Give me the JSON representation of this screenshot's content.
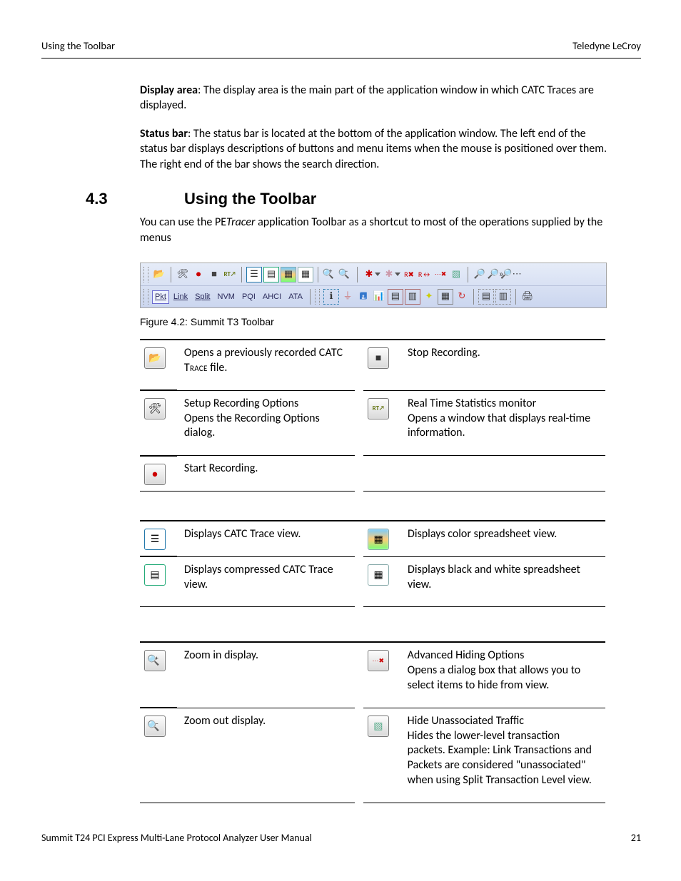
{
  "header": {
    "left": "Using the Toolbar",
    "right": "Teledyne LeCroy"
  },
  "para1_bold": "Display area",
  "para1_rest": ": The display area is the main part of the application window in which CATC Traces are displayed.",
  "para2_bold": "Status bar",
  "para2_rest": ": The status bar is located at the bottom of the application window. The left end of the status bar displays descriptions of buttons and menu items when the mouse is positioned over them. The right end of the bar shows the search direction.",
  "sec_num": "4.3",
  "sec_title": "Using the Toolbar",
  "para3_a": "You can use the PE",
  "para3_b": "Tracer",
  "para3_c": " application Toolbar as a shortcut to most of the operations supplied by the menus",
  "fig_caption": "Figure 4.2:  Summit T3 Toolbar",
  "row2_labels": [
    "Pkt",
    "Link",
    "Split",
    "NVM",
    "PQI",
    "AHCI",
    "ATA"
  ],
  "t1": {
    "r1l": "Opens a previously recorded CATC Trace file.",
    "r1r": "Stop Recording.",
    "r2l": "Setup Recording Options Opens the Recording Options dialog.",
    "r2r": "Real Time Statistics monitor Opens a window that displays real-time information.",
    "r3l": "Start Recording."
  },
  "t2": {
    "r1l": "Displays CATC Trace view.",
    "r1r": "Displays color spreadsheet view.",
    "r2l": "Displays compressed CATC Trace view.",
    "r2r": "Displays black and white spreadsheet view."
  },
  "t3": {
    "r1l": "Zoom in display.",
    "r1r": "Advanced Hiding Options Opens a dialog box that allows you to select items to hide from view.",
    "r2l": "Zoom out display.",
    "r2r": "Hide Unassociated Traffic Hides the lower-level transaction packets. Example: Link Transactions and Packets are considered \"unassociated\" when using Split Transaction Level view."
  },
  "footer": {
    "left": "Summit T24 PCI Express Multi-Lane Protocol Analyzer User Manual",
    "right": "21"
  }
}
